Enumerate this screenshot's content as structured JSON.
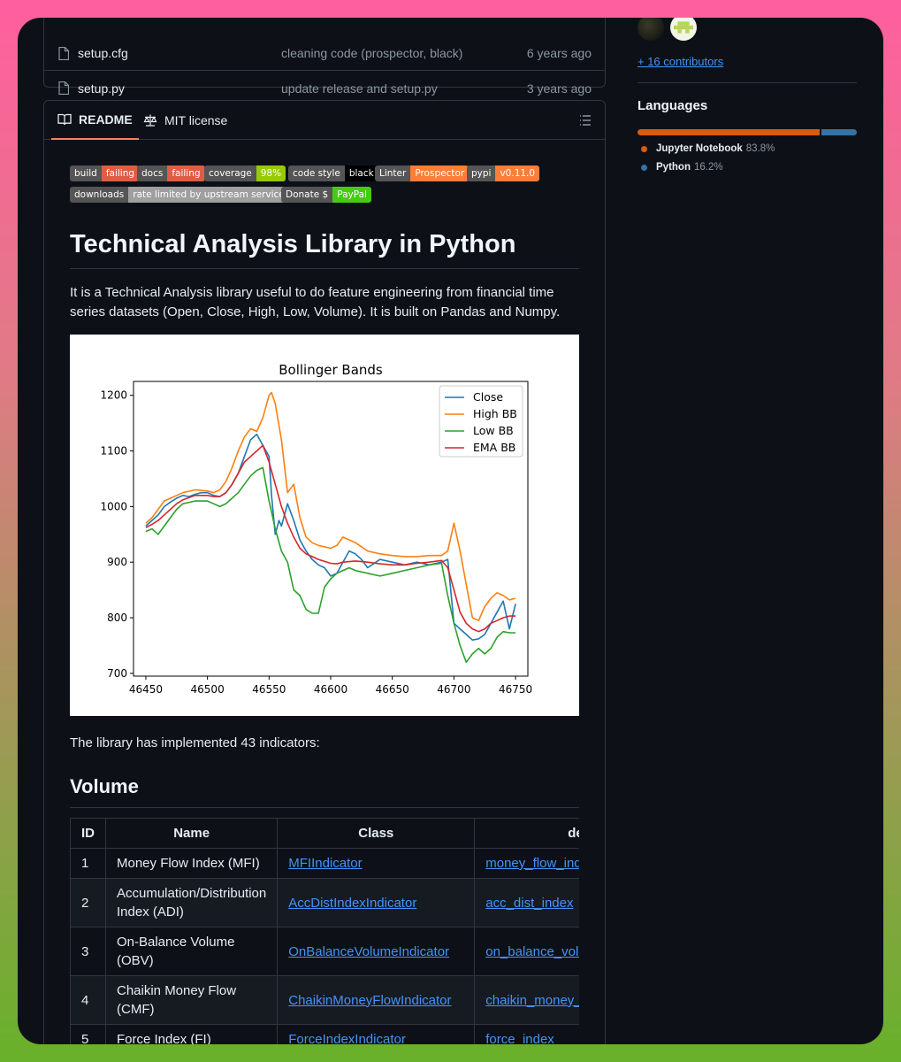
{
  "files": [
    {
      "name": "setup.cfg",
      "message": "cleaning code (prospector, black)",
      "time": "6 years ago"
    },
    {
      "name": "setup.py",
      "message": "update release and setup.py",
      "time": "3 years ago"
    }
  ],
  "tabs": {
    "readme": "README",
    "license": "MIT license"
  },
  "badges": [
    {
      "label": "build",
      "value": "failing",
      "color": "#e05d44"
    },
    {
      "label": "docs",
      "value": "failing",
      "color": "#e05d44"
    },
    {
      "label": "coverage",
      "value": "98%",
      "color": "#97ca00"
    },
    {
      "label": "code style",
      "value": "black",
      "color": "#000000"
    },
    {
      "label": "Linter",
      "value": "Prospector",
      "color": "#fe7d37"
    },
    {
      "label": "pypi",
      "value": "v0.11.0",
      "color": "#fe7d37"
    },
    {
      "label": "downloads",
      "value": "rate limited by upstream service",
      "color": "#9f9f9f"
    },
    {
      "label": "Donate $",
      "value": "PayPal",
      "color": "#4c1"
    }
  ],
  "readme": {
    "title": "Technical Analysis Library in Python",
    "intro": "It is a Technical Analysis library useful to do feature engineering from financial time series datasets (Open, Close, High, Low, Volume). It is built on Pandas and Numpy.",
    "summary": "The library has implemented 43 indicators:",
    "section": "Volume"
  },
  "chart_data": {
    "type": "line",
    "title": "Bollinger Bands",
    "xlim": [
      46440,
      46760
    ],
    "ylim": [
      695,
      1225
    ],
    "xticks": [
      46450,
      46500,
      46550,
      46600,
      46650,
      46700,
      46750
    ],
    "yticks": [
      700,
      800,
      900,
      1000,
      1100,
      1200
    ],
    "legend": "top-right",
    "series": [
      {
        "name": "Close",
        "color": "#1f77b4",
        "x": [
          46450,
          46455,
          46460,
          46465,
          46470,
          46475,
          46480,
          46485,
          46490,
          46495,
          46500,
          46505,
          46510,
          46515,
          46520,
          46525,
          46530,
          46535,
          46540,
          46545,
          46550,
          46552,
          46555,
          46558,
          46560,
          46565,
          46570,
          46575,
          46580,
          46585,
          46590,
          46595,
          46600,
          46605,
          46610,
          46615,
          46620,
          46625,
          46630,
          46640,
          46650,
          46660,
          46670,
          46680,
          46690,
          46695,
          46700,
          46705,
          46710,
          46715,
          46720,
          46725,
          46730,
          46735,
          46740,
          46745,
          46750
        ],
        "y": [
          965,
          975,
          985,
          1000,
          1008,
          1015,
          1020,
          1018,
          1022,
          1025,
          1025,
          1020,
          1018,
          1025,
          1040,
          1060,
          1090,
          1120,
          1130,
          1110,
          1090,
          1020,
          950,
          975,
          965,
          1005,
          975,
          940,
          920,
          905,
          895,
          890,
          875,
          880,
          900,
          920,
          915,
          905,
          890,
          905,
          900,
          895,
          900,
          895,
          900,
          905,
          790,
          780,
          770,
          760,
          762,
          770,
          790,
          810,
          830,
          780,
          825
        ]
      },
      {
        "name": "High BB",
        "color": "#ff7f0e",
        "x": [
          46450,
          46455,
          46460,
          46465,
          46470,
          46475,
          46480,
          46490,
          46500,
          46505,
          46510,
          46515,
          46520,
          46525,
          46530,
          46535,
          46540,
          46545,
          46550,
          46552,
          46555,
          46560,
          46565,
          46570,
          46575,
          46580,
          46585,
          46590,
          46600,
          46605,
          46610,
          46620,
          46630,
          46640,
          46650,
          46660,
          46670,
          46680,
          46690,
          46695,
          46700,
          46705,
          46710,
          46715,
          46720,
          46725,
          46730,
          46735,
          46740,
          46745,
          46750
        ],
        "y": [
          970,
          980,
          995,
          1010,
          1015,
          1020,
          1025,
          1030,
          1028,
          1025,
          1030,
          1045,
          1070,
          1100,
          1125,
          1140,
          1135,
          1160,
          1200,
          1205,
          1185,
          1120,
          1025,
          1040,
          980,
          945,
          935,
          930,
          925,
          930,
          945,
          935,
          920,
          915,
          912,
          910,
          910,
          912,
          912,
          920,
          970,
          920,
          860,
          800,
          795,
          820,
          835,
          845,
          840,
          832,
          835
        ]
      },
      {
        "name": "Low BB",
        "color": "#2ca02c",
        "x": [
          46450,
          46455,
          46460,
          46465,
          46470,
          46475,
          46480,
          46490,
          46500,
          46505,
          46510,
          46515,
          46520,
          46525,
          46530,
          46535,
          46540,
          46545,
          46550,
          46555,
          46560,
          46565,
          46570,
          46575,
          46580,
          46585,
          46590,
          46595,
          46600,
          46605,
          46610,
          46615,
          46620,
          46630,
          46640,
          46650,
          46660,
          46670,
          46680,
          46690,
          46695,
          46700,
          46705,
          46710,
          46715,
          46720,
          46725,
          46730,
          46735,
          46740,
          46745,
          46750
        ],
        "y": [
          955,
          960,
          950,
          965,
          980,
          995,
          1005,
          1010,
          1010,
          1005,
          1000,
          1005,
          1015,
          1025,
          1040,
          1055,
          1065,
          1070,
          1010,
          960,
          920,
          900,
          850,
          840,
          815,
          808,
          808,
          855,
          870,
          880,
          885,
          890,
          885,
          880,
          875,
          880,
          885,
          890,
          895,
          898,
          840,
          790,
          750,
          720,
          735,
          745,
          735,
          745,
          765,
          775,
          773,
          773
        ]
      },
      {
        "name": "EMA BB",
        "color": "#d62728",
        "x": [
          46450,
          46455,
          46460,
          46465,
          46470,
          46475,
          46480,
          46490,
          46500,
          46505,
          46510,
          46515,
          46520,
          46525,
          46530,
          46535,
          46540,
          46545,
          46550,
          46555,
          46560,
          46565,
          46570,
          46575,
          46580,
          46585,
          46590,
          46600,
          46605,
          46610,
          46620,
          46630,
          46640,
          46650,
          46660,
          46670,
          46680,
          46690,
          46695,
          46700,
          46705,
          46710,
          46715,
          46720,
          46725,
          46730,
          46735,
          46740,
          46745,
          46750
        ],
        "y": [
          962,
          968,
          975,
          985,
          995,
          1005,
          1012,
          1020,
          1020,
          1018,
          1018,
          1025,
          1040,
          1060,
          1080,
          1090,
          1100,
          1110,
          1080,
          1040,
          1000,
          970,
          945,
          925,
          915,
          910,
          905,
          898,
          897,
          900,
          902,
          900,
          897,
          895,
          895,
          898,
          900,
          903,
          890,
          850,
          810,
          790,
          780,
          775,
          780,
          790,
          795,
          800,
          803,
          803
        ]
      }
    ]
  },
  "table": {
    "headers": [
      "ID",
      "Name",
      "Class",
      "defs"
    ],
    "rows": [
      {
        "id": "1",
        "name": "Money Flow Index (MFI)",
        "class": "MFIIndicator",
        "def": "money_flow_index"
      },
      {
        "id": "2",
        "name": "Accumulation/Distribution Index (ADI)",
        "class": "AccDistIndexIndicator",
        "def": "acc_dist_index"
      },
      {
        "id": "3",
        "name": "On-Balance Volume (OBV)",
        "class": "OnBalanceVolumeIndicator",
        "def": "on_balance_volume"
      },
      {
        "id": "4",
        "name": "Chaikin Money Flow (CMF)",
        "class": "ChaikinMoneyFlowIndicator",
        "def": "chaikin_money_flow"
      },
      {
        "id": "5",
        "name": "Force Index (FI)",
        "class": "ForceIndexIndicator",
        "def": "force_index"
      }
    ]
  },
  "sidebar": {
    "contributors_link": "+ 16 contributors",
    "languages_title": "Languages",
    "languages": [
      {
        "name": "Jupyter Notebook",
        "percent": "83.8%",
        "fraction": 0.838,
        "color": "#DA5B0B"
      },
      {
        "name": "Python",
        "percent": "16.2%",
        "fraction": 0.162,
        "color": "#3572A5"
      }
    ]
  }
}
